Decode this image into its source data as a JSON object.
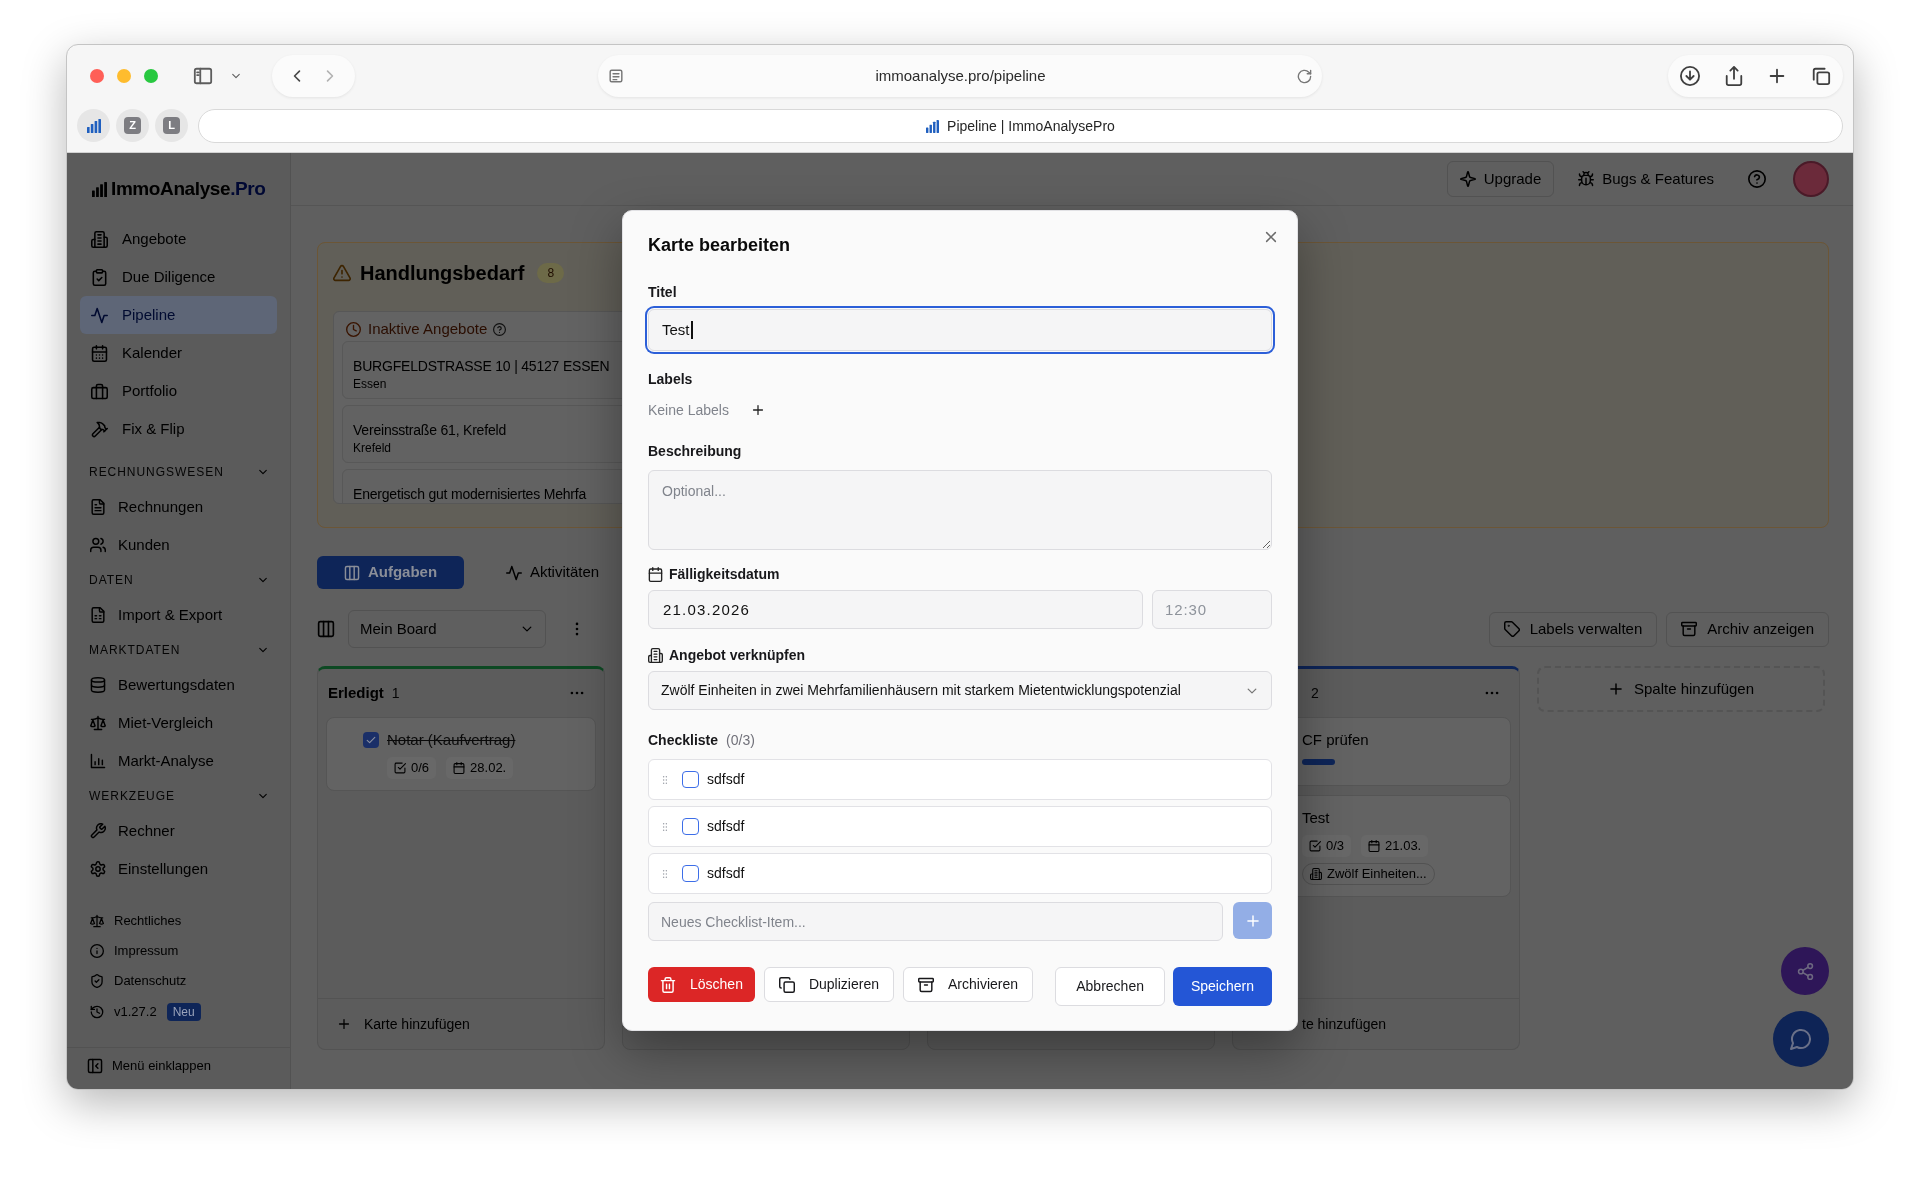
{
  "browser": {
    "url": "immoanalyse.pro/pipeline",
    "tab_title": "Pipeline | ImmoAnalysePro",
    "pinned_tabs": [
      {
        "kind": "icon"
      },
      {
        "kind": "letter",
        "label": "Z"
      },
      {
        "kind": "letter",
        "label": "L"
      }
    ]
  },
  "sidebar": {
    "logo": {
      "name": "ImmoAnalyse",
      "suffix": ".Pro"
    },
    "items": [
      {
        "label": "Angebote",
        "selected": false
      },
      {
        "label": "Due Diligence",
        "selected": false
      },
      {
        "label": "Pipeline",
        "selected": true
      },
      {
        "label": "Kalender",
        "selected": false
      },
      {
        "label": "Portfolio",
        "selected": false
      },
      {
        "label": "Fix & Flip",
        "selected": false
      }
    ],
    "sections": [
      {
        "title": "RECHNUNGSWESEN",
        "expanded": true,
        "items": [
          {
            "label": "Rechnungen",
            "selected": false
          },
          {
            "label": "Kunden",
            "selected": false
          }
        ]
      },
      {
        "title": "DATEN",
        "expanded": true,
        "items": [
          {
            "label": "Import & Export",
            "selected": false
          }
        ]
      },
      {
        "title": "MARKTDATEN",
        "expanded": true,
        "items": [
          {
            "label": "Bewertungsdaten",
            "selected": false
          },
          {
            "label": "Miet-Vergleich",
            "selected": false
          },
          {
            "label": "Markt-Analyse",
            "selected": false
          }
        ]
      },
      {
        "title": "WERKZEUGE",
        "expanded": true,
        "items": [
          {
            "label": "Rechner",
            "selected": false
          },
          {
            "label": "Einstellungen",
            "selected": false
          }
        ]
      }
    ],
    "footer_links": [
      {
        "label": "Rechtliches"
      },
      {
        "label": "Impressum"
      },
      {
        "label": "Datenschutz"
      }
    ],
    "version": {
      "label": "v1.27.2",
      "badge": "Neu"
    },
    "collapse": "Menü einklappen"
  },
  "header": {
    "buttons": [
      {
        "label": "Upgrade",
        "kind": "outline"
      },
      {
        "label": "Bugs & Features",
        "kind": "ghost"
      }
    ]
  },
  "action_panel": {
    "title": "Handlungsbedarf",
    "count": "8",
    "groups": [
      {
        "title": "Inaktive Angebote",
        "items": [
          {
            "title": "BURGFELDSTRASSE 10 | 45127 ESSEN",
            "subtitle": "Essen"
          },
          {
            "title": "Vereinsstraße 61, Krefeld",
            "subtitle": "Krefeld"
          },
          {
            "title": "Energetisch gut modernisiertes Mehrfa"
          }
        ]
      }
    ]
  },
  "view_tabs": [
    {
      "label": "Aufgaben",
      "selected": true
    },
    {
      "label": "Aktivitäten",
      "selected": false
    }
  ],
  "board_toolbar": {
    "board": "Mein Board",
    "buttons": [
      {
        "label": "Labels verwalten"
      },
      {
        "label": "Archiv anzeigen"
      }
    ]
  },
  "columns": [
    {
      "kind": "list",
      "title": "Erledigt",
      "count": "1",
      "color": "#0d4923",
      "cards": [
        {
          "title": "Notar (Kaufvertrag)",
          "done": true,
          "checklist": "0/6",
          "due": "28.02."
        }
      ],
      "add_label": "Karte hinzufügen"
    },
    {
      "kind": "covered"
    },
    {
      "kind": "covered"
    },
    {
      "kind": "partial",
      "count": "2",
      "color": "#0e2558",
      "cards": [
        {
          "title": "CF prüfen",
          "labels": [
            {
              "color": "#0e2558"
            }
          ]
        },
        {
          "title": "Test",
          "checklist": "0/3",
          "due": "21.03.",
          "offer": "Zwölf Einheiten..."
        }
      ],
      "add_label": "te hinzufügen"
    }
  ],
  "add_column": "Spalte hinzufügen",
  "dialog": {
    "title": "Karte bearbeiten",
    "title_field": {
      "label": "Titel",
      "value": "Test",
      "focused": true
    },
    "labels": {
      "label": "Labels",
      "empty_text": "Keine Labels"
    },
    "description": {
      "label": "Beschreibung",
      "placeholder": "Optional..."
    },
    "due": {
      "label": "Fälligkeitsdatum",
      "date": "21.03.2026",
      "time_placeholder": "12:30"
    },
    "offer": {
      "label": "Angebot verknüpfen",
      "value": "Zwölf Einheiten in zwei Mehrfamilienhäusern mit starkem Mietentwicklungspotenzial"
    },
    "checklist": {
      "label": "Checkliste",
      "count": "(0/3)",
      "items": [
        {
          "text": "sdfsdf",
          "checked": false
        },
        {
          "text": "sdfsdf",
          "checked": false
        },
        {
          "text": "sdfsdf",
          "checked": false
        }
      ],
      "new_item_placeholder": "Neues Checklist-Item...",
      "add_disabled": true
    },
    "actions": [
      {
        "label": "Löschen",
        "kind": "danger"
      },
      {
        "label": "Duplizieren",
        "kind": "secondary"
      },
      {
        "label": "Archivieren",
        "kind": "secondary"
      },
      {
        "label": "Abbrechen",
        "kind": "cancel"
      },
      {
        "label": "Speichern",
        "kind": "primary"
      }
    ]
  }
}
